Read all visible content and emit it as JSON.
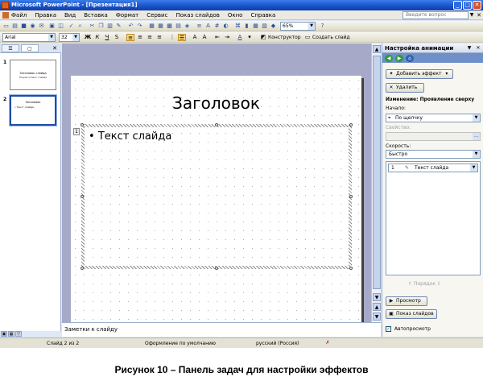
{
  "window": {
    "title": "Microsoft PowerPoint - [Презентация1]",
    "buttons": [
      "_",
      "□",
      "✕"
    ]
  },
  "menu": {
    "items": [
      "Файл",
      "Правка",
      "Вид",
      "Вставка",
      "Формат",
      "Сервис",
      "Показ слайдов",
      "Окно",
      "Справка"
    ],
    "help_placeholder": "Введите вопрос"
  },
  "toolbar": {
    "zoom": "65%"
  },
  "format_toolbar": {
    "font": "Arial",
    "size": "32",
    "bold": "Ж",
    "italic": "К",
    "underline": "Ч",
    "shadow": "S",
    "designer": "Конструктор",
    "new_slide": "Создать слайд"
  },
  "outline": {
    "slides": [
      {
        "num": "1",
        "title": "Заголовок слайда",
        "subtitle": "Подзаголовок слайда"
      },
      {
        "num": "2",
        "title": "Заголовок",
        "body": "• Текст слайда"
      }
    ]
  },
  "slide": {
    "title": "Заголовок",
    "bullet": "•",
    "body": "Текст слайда",
    "anim_marker": "1"
  },
  "notes": {
    "placeholder": "Заметки к слайду"
  },
  "taskpane": {
    "title": "Настройка анимации",
    "add_effect": "Добавить эффект",
    "remove": "Удалить",
    "change_label": "Изменение: Проявление сверху",
    "start_label": "Начало:",
    "start_value": "По щелчку",
    "property_label": "Свойство:",
    "speed_label": "Скорость:",
    "speed_value": "Быстро",
    "item_num": "1",
    "item_label": "Текст слайда",
    "reorder": "Порядок",
    "preview": "Просмотр",
    "slideshow": "Показ слайдов",
    "autopreview": "Автопросмотр"
  },
  "status": {
    "slide_count": "Слайд 2 из 2",
    "design": "Оформление по умолчанию",
    "language": "русский (Россия)"
  },
  "caption": "Рисунок 10 – Панель задач для настройки эффектов"
}
